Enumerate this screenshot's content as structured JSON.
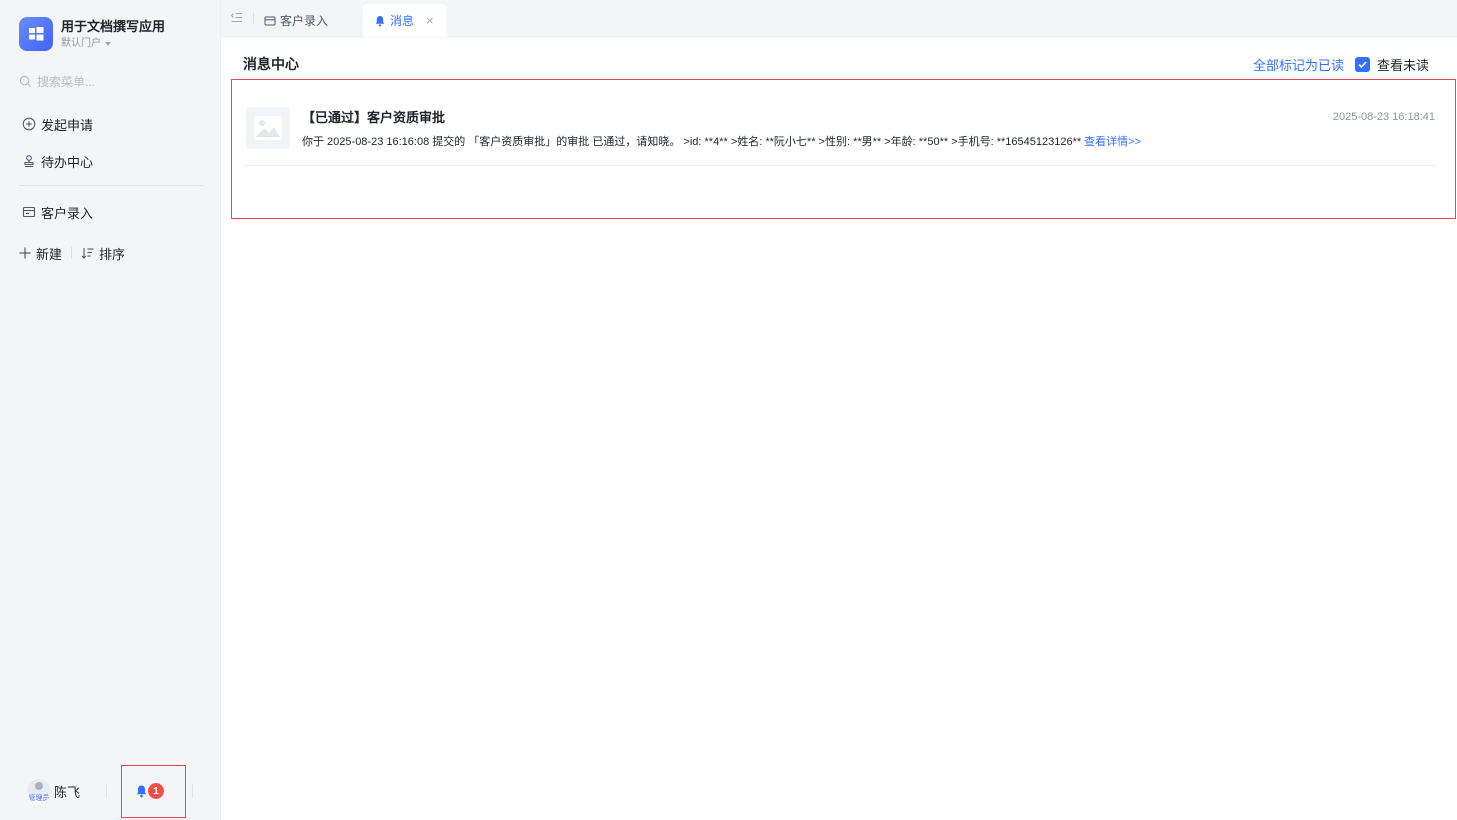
{
  "app": {
    "title": "用于文档撰写应用",
    "portal": "默认门户"
  },
  "search": {
    "placeholder": "搜索菜单..."
  },
  "nav": {
    "start_request": "发起申请",
    "todo_center": "待办中心",
    "customer_entry": "客户录入"
  },
  "actions": {
    "new": "新建",
    "sort": "排序"
  },
  "footer": {
    "user_name": "陈飞",
    "role_tag": "管理员",
    "notification_count": "1"
  },
  "tabs": [
    {
      "label": "客户录入"
    },
    {
      "label": "消息"
    }
  ],
  "main": {
    "title": "消息中心",
    "mark_all_read": "全部标记为已读",
    "view_unread": "查看未读",
    "view_unread_checked": true
  },
  "messages": [
    {
      "title": "【已通过】客户资质审批",
      "time": "2025-08-23 16:18:41",
      "body": "你于 2025-08-23 16:16:08 提交的 「客户资质审批」的审批 已通过，请知晓。 >id: **4** >姓名: **阮小七** >性别: **男** >年龄: **50** >手机号: **16545123126**",
      "link": "查看详情>>"
    }
  ],
  "colors": {
    "accent": "#3370ff",
    "badge": "#f24d4d",
    "highlight_border": "#e5484d"
  }
}
